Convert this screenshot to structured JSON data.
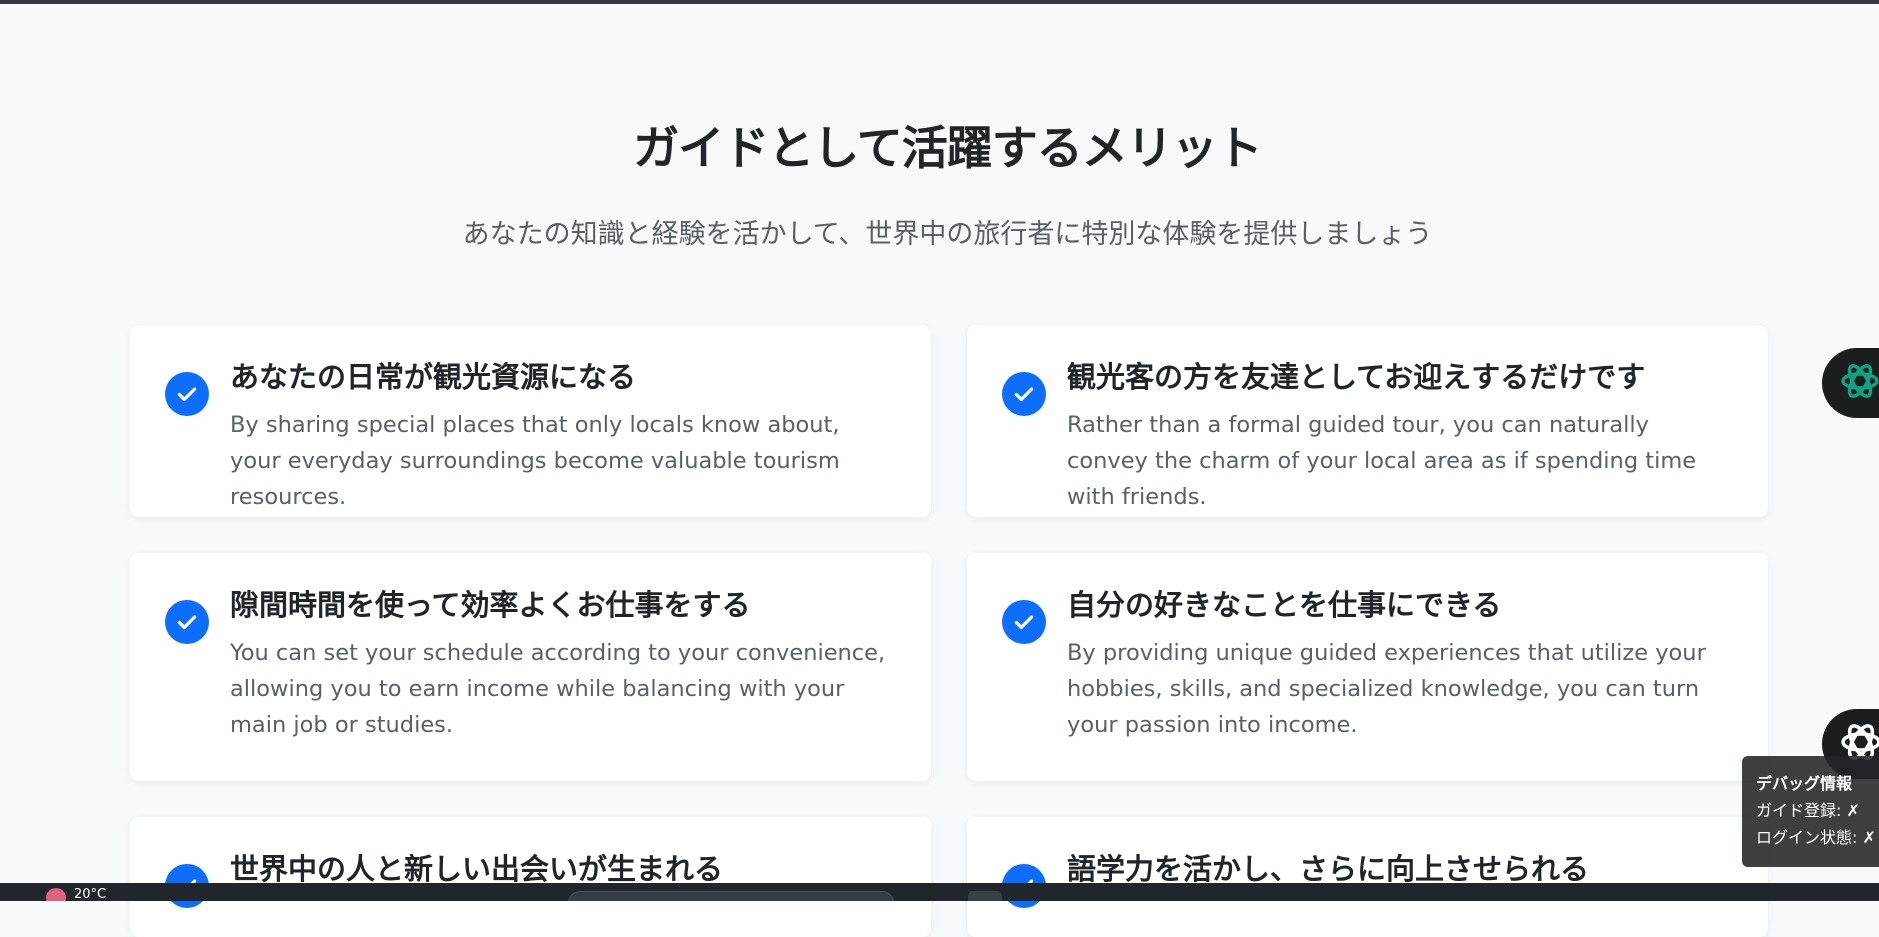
{
  "section": {
    "title": "ガイドとして活躍するメリット",
    "subtitle": "あなたの知識と経験を活かして、世界中の旅行者に特別な体験を提供しましょう"
  },
  "benefits": [
    {
      "title": "あなたの日常が観光資源になる",
      "description": "By sharing special places that only locals know about, your everyday surroundings become valuable tourism resources."
    },
    {
      "title": "観光客の方を友達としてお迎えするだけです",
      "description": "Rather than a formal guided tour, you can naturally convey the charm of your local area as if spending time with friends."
    },
    {
      "title": "隙間時間を使って効率よくお仕事をする",
      "description": "You can set your schedule according to your convenience, allowing you to earn income while balancing with your main job or studies."
    },
    {
      "title": "自分の好きなことを仕事にできる",
      "description": "By providing unique guided experiences that utilize your hobbies, skills, and specialized knowledge, you can turn your passion into income."
    },
    {
      "title": "世界中の人と新しい出会いが生まれる",
      "description": ""
    },
    {
      "title": "語学力を活かし、さらに向上させられる",
      "description": ""
    }
  ],
  "debug": {
    "title": "デバッグ情報",
    "guide_registration": "ガイド登録: ✗",
    "login_status": "ログイン状態: ✗"
  },
  "taskbar": {
    "temperature": "20°C"
  },
  "colors": {
    "accent": "#0d6efd",
    "background": "#f8f9fa",
    "card": "#ffffff",
    "chatgpt_green": "#10a37f"
  },
  "icons": [
    "check-circle-icon",
    "chatgpt-icon",
    "openai-icon"
  ]
}
